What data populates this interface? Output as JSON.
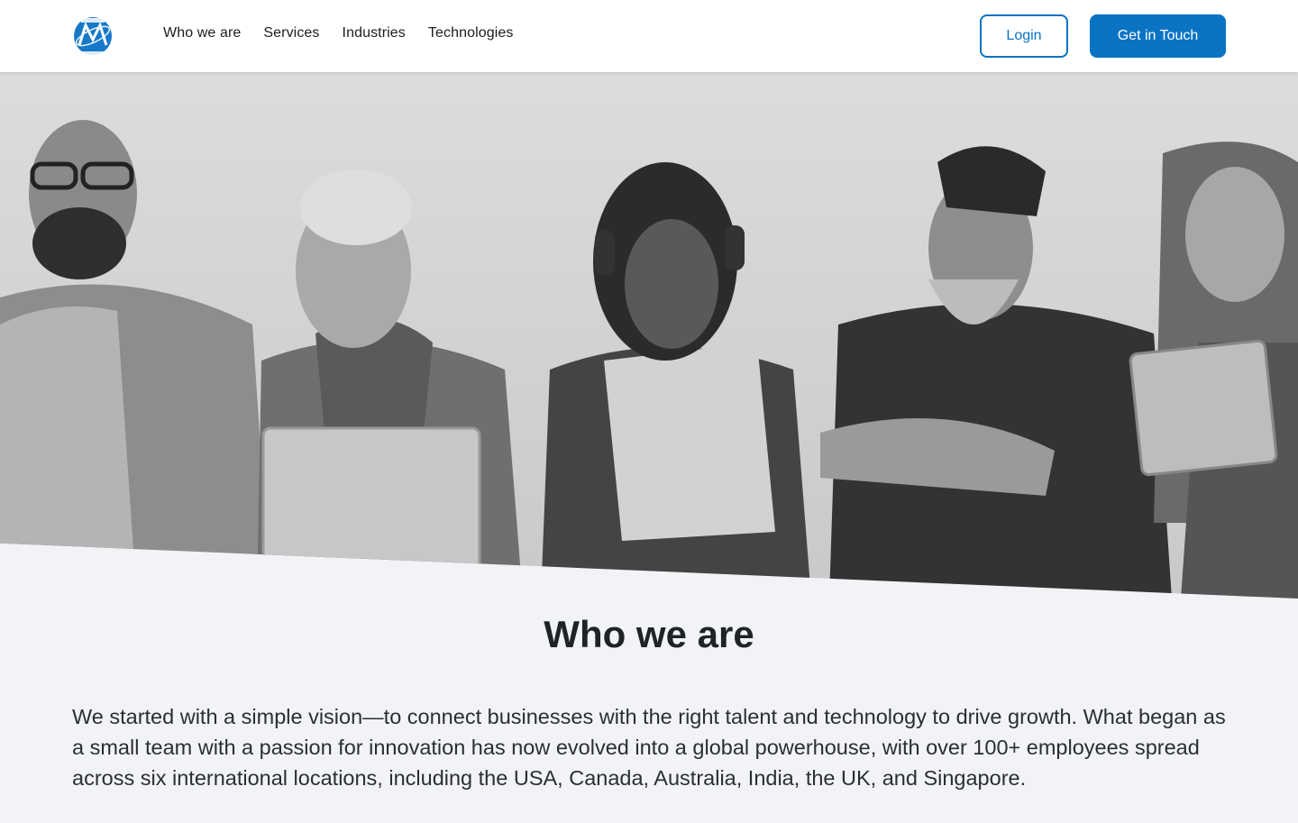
{
  "header": {
    "logo_icon": "mesons-technologies-logo",
    "nav": [
      "Who we are",
      "Services",
      "Industries",
      "Technologies"
    ],
    "login_label": "Login",
    "contact_label": "Get in Touch",
    "accent_color": "#0a73c4"
  },
  "hero": {
    "image": "black-and-white-photo-of-five-people-smiling-with-laptop-headphones-and-tablet"
  },
  "section": {
    "title": "Who we are",
    "body": "We started with a simple vision—to connect businesses with the right talent and technology to drive growth. What began as a small team with a passion for innovation has now evolved into a global powerhouse, with over 100+ employees spread across six international locations, including the USA, Canada, Australia, India, the UK, and Singapore."
  }
}
